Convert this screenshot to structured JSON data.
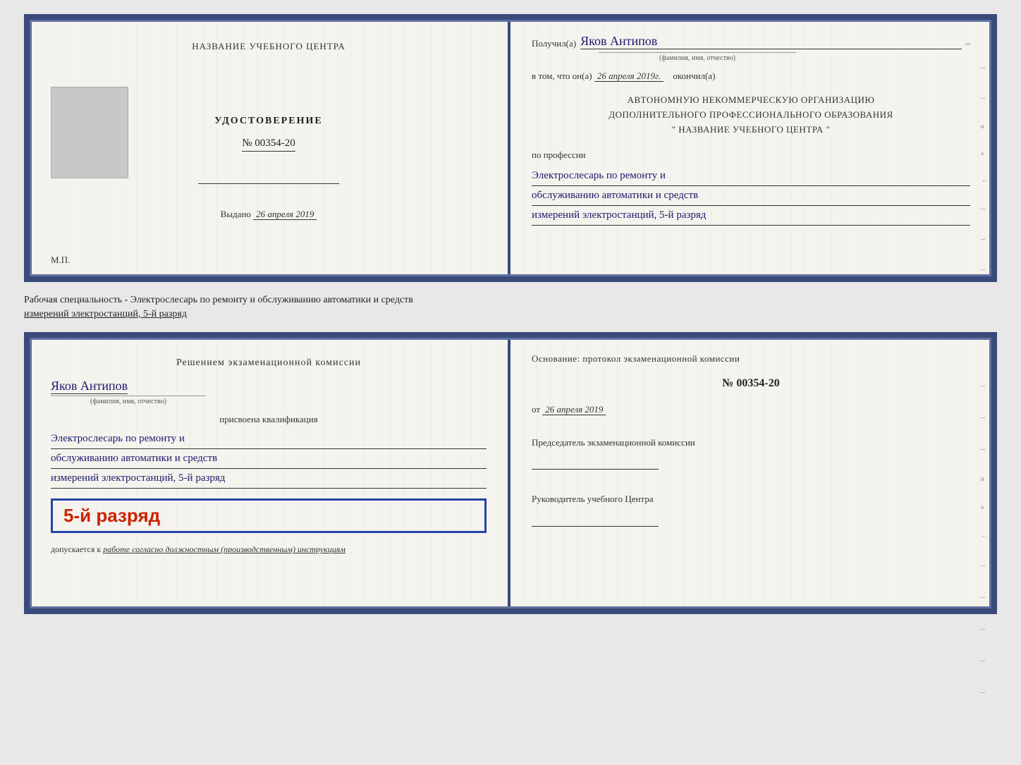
{
  "top_doc": {
    "left": {
      "center_title": "НАЗВАНИЕ УЧЕБНОГО ЦЕНТРА",
      "gray_box_alt": "photo placeholder",
      "cert_title": "УДОСТОВЕРЕНИЕ",
      "cert_number": "№ 00354-20",
      "issued_label": "Выдано",
      "issued_date": "26 апреля 2019",
      "mp_label": "М.П."
    },
    "right": {
      "received_label": "Получил(а)",
      "recipient_name": "Яков Антипов",
      "fio_caption": "(фамилия, имя, отчество)",
      "date_line_label": "в том, что он(а)",
      "date_value": "26 апреля 2019г.",
      "finished_label": "окончил(а)",
      "org_line1": "АВТОНОМНУЮ НЕКОММЕРЧЕСКУЮ ОРГАНИЗАЦИЮ",
      "org_line2": "ДОПОЛНИТЕЛЬНОГО ПРОФЕССИОНАЛЬНОГО ОБРАЗОВАНИЯ",
      "org_line3": "\"    НАЗВАНИЕ УЧЕБНОГО ЦЕНТРА    \"",
      "profession_label": "по профессии",
      "profession_line1": "Электрослесарь по ремонту и",
      "profession_line2": "обслуживанию автоматики и средств",
      "profession_line3": "измерений электростанций, 5-й разряд"
    }
  },
  "separator": {
    "text": "Рабочая специальность - Электрослесарь по ремонту и обслуживанию автоматики и средств\nизмерений электростанций, 5-й разряд"
  },
  "bottom_doc": {
    "left": {
      "commission_title": "Решением экзаменационной комиссии",
      "person_name": "Яков Антипов",
      "fio_caption": "(фамилия, имя, отчество)",
      "assigned_label": "присвоена квалификация",
      "qual_line1": "Электрослесарь по ремонту и",
      "qual_line2": "обслуживанию автоматики и средств",
      "qual_line3": "измерений электростанций, 5-й разряд",
      "rank_badge": "5-й разряд",
      "admitted_label": "допускается к",
      "admitted_text": "работе согласно должностным (производственным) инструкциям"
    },
    "right": {
      "osnov_label": "Основание: протокол экзаменационной  комиссии",
      "protocol_number": "№  00354-20",
      "from_date_label": "от",
      "from_date_value": "26 апреля 2019",
      "chairman_label": "Председатель экзаменационной комиссии",
      "head_label": "Руководитель учебного Центра"
    }
  }
}
